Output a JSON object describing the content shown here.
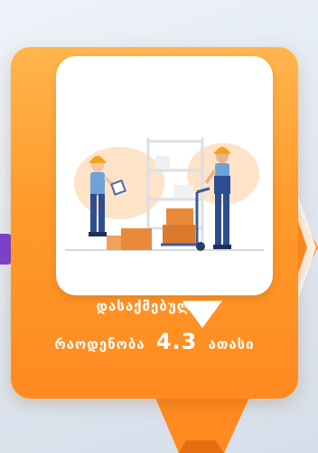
{
  "stat_card": {
    "label_line1": "დასაქმებულთა",
    "label_prefix": "რაოდენობა",
    "value": "4.3",
    "unit": "ათასი",
    "illustration_icon": "warehouse-workers-illustration"
  },
  "colors": {
    "card_orange": "#ff9a2b",
    "card_highlight": "#ffb54d",
    "bubble": "#ffffff",
    "accent_purple": "#7b3fd0",
    "worker_uniform": "#2f4e8f",
    "helmet": "#f5a21c",
    "box": "#e98a3a"
  }
}
